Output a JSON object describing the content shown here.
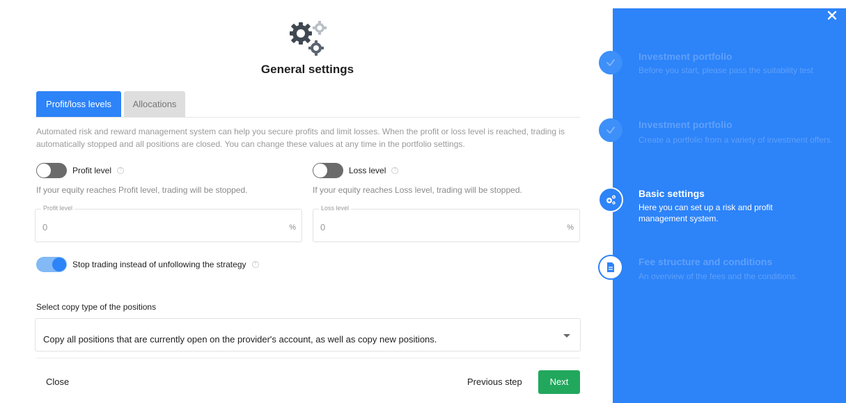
{
  "header": {
    "title": "General settings",
    "icon": "gears-icon"
  },
  "tabs": [
    {
      "label": "Profit/loss levels",
      "active": true
    },
    {
      "label": "Allocations",
      "active": false
    }
  ],
  "description": "Automated risk and reward management system can help you secure profits and limit losses. When the profit or loss level is reached, trading is automatically stopped and all positions are closed. You can change these values at any time in the portfolio settings.",
  "profit": {
    "toggle_label": "Profit level",
    "enabled": false,
    "hint": "If your equity reaches Profit level, trading will be stopped.",
    "field_label": "Profit level",
    "value": "0",
    "unit": "%"
  },
  "loss": {
    "toggle_label": "Loss level",
    "enabled": false,
    "hint": "If your equity reaches Loss level, trading will be stopped.",
    "field_label": "Loss level",
    "value": "0",
    "unit": "%"
  },
  "stop_trading": {
    "label": "Stop trading instead of unfollowing the strategy",
    "enabled": true
  },
  "copy_type": {
    "title": "Select copy type of the positions",
    "selected": "Copy all positions that are currently open on the provider's account, as well as copy new positions."
  },
  "footer": {
    "close_label": "Close",
    "prev_label": "Previous step",
    "next_label": "Next"
  },
  "steps": [
    {
      "title": "Investment portfolio",
      "subtitle": "Before you start, please pass the suitability test",
      "state": "done",
      "icon": "check-icon"
    },
    {
      "title": "Investment portfolio",
      "subtitle": "Create a portfolio from a variety of investment offers.",
      "state": "done",
      "icon": "check-icon"
    },
    {
      "title": "Basic settings",
      "subtitle": "Here you can set up a risk and profit management system.",
      "state": "active",
      "icon": "gears-icon"
    },
    {
      "title": "Fee structure and conditions",
      "subtitle": "An overview of the fees and the conditions.",
      "state": "todo",
      "icon": "document-icon"
    }
  ],
  "colors": {
    "primary": "#2d83f8",
    "next_button": "#21a85c",
    "faded_text": "#5fa0fa"
  }
}
